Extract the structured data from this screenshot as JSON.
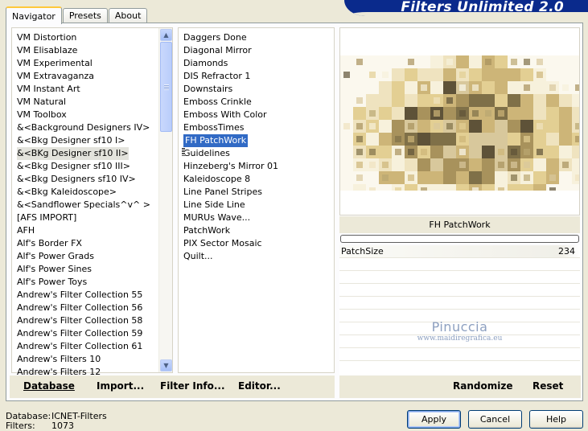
{
  "window": {
    "banner_title": "Filters Unlimited 2.0"
  },
  "tabs": [
    {
      "label": "Navigator",
      "active": true
    },
    {
      "label": "Presets",
      "active": false
    },
    {
      "label": "About",
      "active": false
    }
  ],
  "categories": {
    "items": [
      "VM Distortion",
      "VM Elisablaze",
      "VM Experimental",
      "VM Extravaganza",
      "VM Instant Art",
      "VM Natural",
      "VM Toolbox",
      "&<Background Designers IV>",
      "&<Bkg Designer sf10 I>",
      "&<BKg Designer sf10 II>",
      "&<Bkg Designer sf10 III>",
      "&<Bkg Designers sf10 IV>",
      "&<Bkg Kaleidoscope>",
      "&<Sandflower Specials^v^ >",
      "[AFS IMPORT]",
      "AFH",
      "Alf's Border FX",
      "Alf's Power Grads",
      "Alf's Power Sines",
      "Alf's Power Toys",
      "Andrew's Filter Collection 55",
      "Andrew's Filter Collection 56",
      "Andrew's Filter Collection 58",
      "Andrew's Filter Collection 59",
      "Andrew's Filter Collection 61",
      "Andrew's Filters 10",
      "Andrew's Filters 12"
    ],
    "selected_index": 9
  },
  "filters": {
    "items": [
      "Daggers Done",
      "Diagonal Mirror",
      "Diamonds",
      "DIS Refractor 1",
      "Downstairs",
      "Emboss Crinkle",
      "Emboss With Color",
      "EmbossTimes",
      "FH PatchWork",
      "Guidelines",
      "Hinzeberg's Mirror 01",
      "Kaleidoscope 8",
      "Line Panel Stripes",
      "Line Side Line",
      "MURUs Wave...",
      "PatchWork",
      "PIX Sector Mosaic",
      "Quilt..."
    ],
    "selected_index": 8
  },
  "preview": {
    "filter_name": "FH PatchWork",
    "progress": 0
  },
  "parameters": [
    {
      "label": "PatchSize",
      "value": "234"
    }
  ],
  "watermark": {
    "line1": "Pinuccia",
    "line2": "www.maidiregrafica.eu"
  },
  "toolbar": {
    "database": "Database",
    "import": "Import...",
    "filter_info": "Filter Info...",
    "editor": "Editor...",
    "randomize": "Randomize",
    "reset": "Reset"
  },
  "footer": {
    "database_label": "Database:",
    "database_value": "ICNET-Filters",
    "filters_label": "Filters:",
    "filters_value": "1073",
    "apply": "Apply",
    "cancel": "Cancel",
    "help": "Help"
  }
}
